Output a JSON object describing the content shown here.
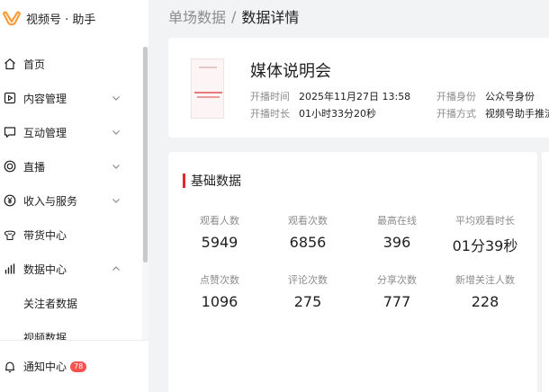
{
  "app": {
    "name": "视频号 · 助手"
  },
  "sidebar": {
    "items": [
      {
        "label": "首页",
        "icon": "home-icon"
      },
      {
        "label": "内容管理",
        "icon": "content-icon",
        "expandable": true
      },
      {
        "label": "互动管理",
        "icon": "chat-icon",
        "expandable": true
      },
      {
        "label": "直播",
        "icon": "live-icon",
        "expandable": true
      },
      {
        "label": "收入与服务",
        "icon": "yuan-icon",
        "expandable": true
      },
      {
        "label": "带货中心",
        "icon": "shop-icon"
      },
      {
        "label": "数据中心",
        "icon": "chart-icon",
        "expanded": true
      }
    ],
    "sub_items": [
      {
        "label": "关注者数据"
      },
      {
        "label": "视频数据"
      }
    ],
    "notification": {
      "label": "通知中心",
      "count": "78"
    }
  },
  "breadcrumb": {
    "parent": "单场数据",
    "separator": "/",
    "current": "数据详情"
  },
  "live": {
    "title": "媒体说明会",
    "start_time_label": "开播时间",
    "start_time": "2025年11月27日 13:58",
    "duration_label": "开播时长",
    "duration": "01小时33分20秒",
    "identity_label": "开播身份",
    "identity": "公众号身份",
    "method_label": "开播方式",
    "method": "视频号助手推流"
  },
  "stats": {
    "title": "基础数据",
    "items": [
      {
        "label": "观看人数",
        "value": "5949"
      },
      {
        "label": "观看次数",
        "value": "6856"
      },
      {
        "label": "最高在线",
        "value": "396"
      },
      {
        "label": "平均观看时长",
        "value": "01分39秒"
      },
      {
        "label": "点赞次数",
        "value": "1096"
      },
      {
        "label": "评论次数",
        "value": "275"
      },
      {
        "label": "分享次数",
        "value": "777"
      },
      {
        "label": "新增关注人数",
        "value": "228"
      }
    ]
  },
  "colors": {
    "accent": "#fa9d3b",
    "section_bar": "#e0292b",
    "badge": "#fa5151"
  }
}
